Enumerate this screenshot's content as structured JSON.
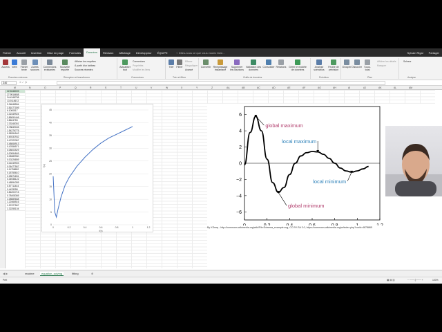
{
  "ribbon_tabs": [
    "Fichier",
    "Accueil",
    "Insertion",
    "Mise en page",
    "Formules",
    "Données",
    "Révision",
    "Affichage",
    "Développeur",
    "ÉQUIPE"
  ],
  "active_tab": "Données",
  "tell_me": "Dites-nous ce que vous voulez faire...",
  "user": "Sylvain Rigal",
  "share": "Partager",
  "ribbon": {
    "get_data": [
      {
        "label": "Access"
      },
      {
        "label": "Web"
      },
      {
        "label": "Fichier texte"
      },
      {
        "label": "Autres sources"
      }
    ],
    "group_external": "Données externes",
    "connections_existing": "Connexions existantes",
    "new_query": "Nouvelle requête",
    "show_queries": "Afficher les requêtes",
    "from_table": "À partir d'un tableau",
    "recent_sources": "Sources récentes",
    "group_get_transform": "Récupérer et transformer",
    "refresh_all": "Actualiser tout",
    "connections": "Connexions",
    "properties": "Propriétés",
    "edit_links": "Modifier les liens",
    "group_connections": "Connexions",
    "sort": "Trier",
    "filter": "Filtrer",
    "clear": "Effacer",
    "reapply": "Réappliquer",
    "advanced": "Avancé",
    "group_sort": "Trier et filtrer",
    "text_to_columns": "Convertir",
    "flash_fill": "Remplissage instantané",
    "remove_duplicates": "Supprimer les doublons",
    "data_validation": "Validation des données",
    "consolidate": "Consolider",
    "relationships": "Relations",
    "data_model": "Gérer le modèle de données",
    "group_tools": "Outils de données",
    "what_if": "Analyse scénarios",
    "forecast": "Feuille de prévision",
    "group_forecast": "Prévision",
    "group_btn": "Grouper",
    "ungroup": "Dissocier",
    "subtotal": "Sous-total",
    "show_detail": "Afficher les détails",
    "hide_detail": "Masquer",
    "group_outline": "Plan",
    "solver": "Solveur",
    "group_analysis": "Analyse"
  },
  "name_box": "Z40",
  "columns": [
    "M",
    "N",
    "O",
    "P",
    "Q",
    "R",
    "S",
    "T",
    "U",
    "V",
    "W",
    "X",
    "Y",
    "Z",
    "AA",
    "AB",
    "AC",
    "AD",
    "AE",
    "AF",
    "AG",
    "AH",
    "AI",
    "AJ",
    "AK",
    "AL",
    "AM"
  ],
  "cells": [
    "22.5348009",
    "27.9916658",
    "34.4348758",
    "13.9115672",
    "9.34848554",
    "3.51077009",
    "6.1000517",
    "4.32449924",
    "3.85090446",
    "3.8624753",
    "2.33348351",
    "5.78849045",
    "1.54276775",
    "0.98394542",
    "0.69332932",
    "0.47222367",
    "0.48066913",
    "0.47656571",
    "0.08003529",
    "0.00994849",
    "0.08389950",
    "0.00226859",
    "0.02249903",
    "0.06477567",
    "0.11758652",
    "0.18755610",
    "0.28574831",
    "0.34938122",
    "0.48594355",
    "0.57711444",
    "0.4433358",
    "0.84202715",
    "0.78408365",
    "1.08589668",
    "1.22466516",
    "1.30727567",
    "1.32255104"
  ],
  "chart1": {
    "x_ticks": [
      "0",
      "0.2",
      "0.4",
      "0.6",
      "0.8",
      "1",
      "1.2"
    ],
    "y_ticks": [
      "0",
      "5",
      "10",
      "15",
      "20",
      "25",
      "30",
      "35",
      "40",
      "45"
    ],
    "xlabel": "f(x)",
    "ylabel": "f(x)"
  },
  "chart_data": [
    {
      "type": "line",
      "x": [
        0.0,
        0.02,
        0.04,
        0.06,
        0.1,
        0.15,
        0.2,
        0.3,
        0.4,
        0.5,
        0.6,
        0.7,
        0.8,
        0.9,
        1.0
      ],
      "series": [
        {
          "values": [
            19,
            5,
            3,
            6,
            11,
            15.5,
            18.5,
            23,
            26.5,
            29.5,
            32,
            34,
            35.5,
            37,
            38.5
          ]
        }
      ],
      "xlim": [
        0,
        1.2
      ],
      "ylim": [
        0,
        45
      ],
      "xlabel": "f(x)",
      "ylabel": "f(x)"
    },
    {
      "type": "line",
      "x": [
        0.0,
        0.05,
        0.1,
        0.15,
        0.2,
        0.25,
        0.3,
        0.35,
        0.4,
        0.45,
        0.5,
        0.55,
        0.6,
        0.65,
        0.7,
        0.75,
        0.8,
        0.85,
        0.9,
        0.95,
        1.0,
        1.05,
        1.1
      ],
      "series": [
        {
          "values": [
            -0.2,
            3.8,
            5.8,
            4.0,
            0.5,
            -2.4,
            -3.6,
            -3.0,
            -1.4,
            0.0,
            0.9,
            1.3,
            1.45,
            1.4,
            1.1,
            0.6,
            0.0,
            -0.6,
            -0.95,
            -1.1,
            -0.95,
            -0.7,
            -0.4
          ]
        }
      ],
      "xlim": [
        0,
        1.2
      ],
      "ylim": [
        -7,
        7
      ],
      "x_ticks": [
        "0",
        "0.2",
        "0.4",
        "0.6",
        "0.8",
        "1",
        "1.2"
      ],
      "y_ticks": [
        "−6",
        "−4",
        "−2",
        "0",
        "2",
        "4",
        "6"
      ],
      "annotations": [
        {
          "text": "global maximum",
          "color": "#b03a6a",
          "x": 0.1,
          "y": 5.8
        },
        {
          "text": "local maximum",
          "color": "#2a7fb8",
          "x": 0.65,
          "y": 1.45
        },
        {
          "text": "local minimum",
          "color": "#2a7fb8",
          "x": 0.95,
          "y": -1.1
        },
        {
          "text": "global minimum",
          "color": "#b03a6a",
          "x": 0.3,
          "y": -3.6
        }
      ]
    }
  ],
  "credit": "By KSmrq - http://commons.wikimedia.org/wiki/File:Extrema_example.svg, CC BY-SA 3.0, https://commons.wikimedia.org/w/index.php?curid=4878865",
  "sheet_tabs": [
    "readme",
    "equation_solving",
    "fitting"
  ],
  "active_sheet": "equation_solving",
  "status": "Prêt",
  "zoom": "100%",
  "accent": "#217346"
}
